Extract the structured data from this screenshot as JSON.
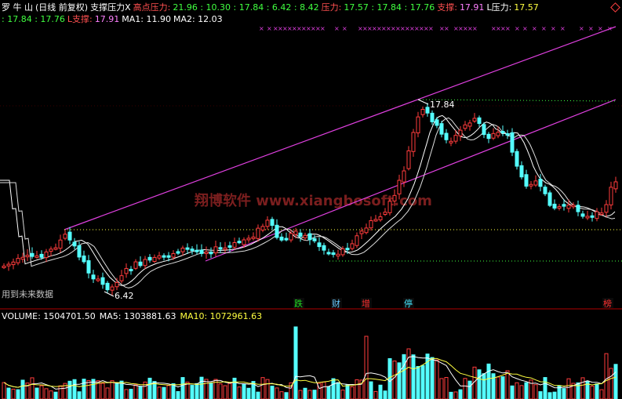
{
  "header": {
    "stock_name": "罗 牛 山",
    "period": "(日线 前复权)",
    "indicator": "支撑压力X",
    "high_label": "高点压力:",
    "high_values": "21.96 : 10.30 : 17.84 : 6.42 : 8.42",
    "pressure_label": "压力:",
    "pressure_values": "17.57 : 17.84 : 17.76",
    "support_label": "支撑:",
    "support_value": "17.91",
    "lpressure_label": "L压力:",
    "lpressure_value": "17.57",
    "line2_values": ": 17.84 : 17.76",
    "lsupport_label": "L支撑:",
    "lsupport_value": "17.91",
    "ma1": "MA1: 11.90",
    "ma2": "MA2: 12.03"
  },
  "annotations": {
    "peak_price": "17.84",
    "low_price": "6.42",
    "future_data_note": "用到未来数据",
    "watermark": "翔博软件 www.xiangbosoft.com"
  },
  "event_tags": [
    {
      "label": "跌",
      "color": "#22e022"
    },
    {
      "label": "财",
      "color": "#66c8ff"
    },
    {
      "label": "增",
      "color": "#ff3030"
    },
    {
      "label": "停",
      "color": "#44e6ff"
    },
    {
      "label": "榜",
      "color": "#ff3030"
    }
  ],
  "volume": {
    "label": "VOLUME: 1504701.50",
    "ma5": "MA5: 1303881.63",
    "ma10": "MA10: 1072961.63"
  },
  "colors": {
    "up": "#ff3c3c",
    "down": "#54ffff",
    "ma_line": "#ffffff",
    "trend_line": "#e040e0",
    "support_dots": "#ffff40",
    "green_dots": "#40ff40"
  }
}
